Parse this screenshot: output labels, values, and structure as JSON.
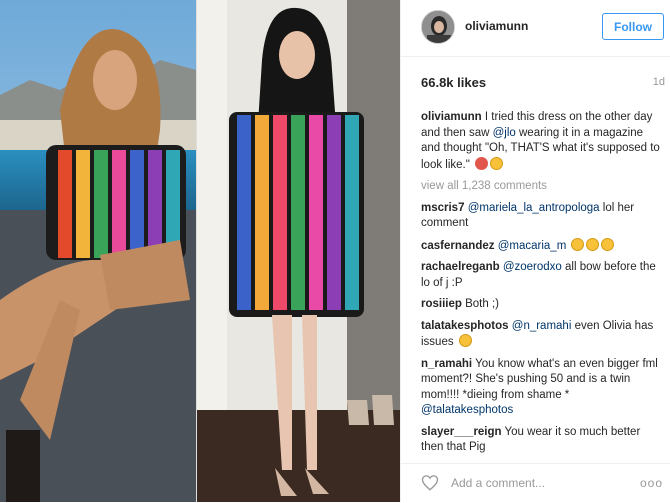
{
  "post": {
    "username": "oliviamunn",
    "follow_label": "Follow",
    "likes": "66.8k likes",
    "age": "1d",
    "caption_user": "oliviamunn",
    "caption_text_1": " I tried this dress on the other day and then saw ",
    "caption_mention": "@jlo",
    "caption_text_2": " wearing it in a magazine and thought \"Oh, THAT'S what it's supposed to look like.\" ",
    "view_all": "view all 1,238 comments"
  },
  "comments": [
    {
      "user": "mscris7",
      "mention": "@mariela_la_antropologa",
      "text": " lol her comment"
    },
    {
      "user": "casfernandez",
      "mention": "@macaria_m",
      "text": ""
    },
    {
      "user": "rachaelreganb",
      "mention": "@zoerodxo",
      "text": " all bow before the lo of j :P"
    },
    {
      "user": "rosiiiep",
      "mention": "",
      "text": " Both ;)"
    },
    {
      "user": "talatakesphotos",
      "mention": "@n_ramahi",
      "text": " even Olivia has issues "
    },
    {
      "user": "n_ramahi",
      "mention": "",
      "text": " You know what's an even bigger fml moment?! She's pushing 50 and is a twin mom!!!! *dieing from shame * "
    },
    {
      "user": "slayer___reign",
      "mention": "",
      "text": " You wear it so much better then that Pig"
    }
  ],
  "extras": {
    "n_ramahi_mention": "@talatakesphotos"
  },
  "footer": {
    "add_comment_placeholder": "Add a comment...",
    "more_label": "ooo"
  },
  "icons": {
    "heart": "heart-icon",
    "more": "more-options-icon",
    "emoji_angry": "angry-face-emoji",
    "emoji_laugh": "laughing-crying-emoji"
  },
  "colors": {
    "accent": "#3897f0",
    "mention": "#003569",
    "muted": "#999999",
    "text": "#262626"
  }
}
